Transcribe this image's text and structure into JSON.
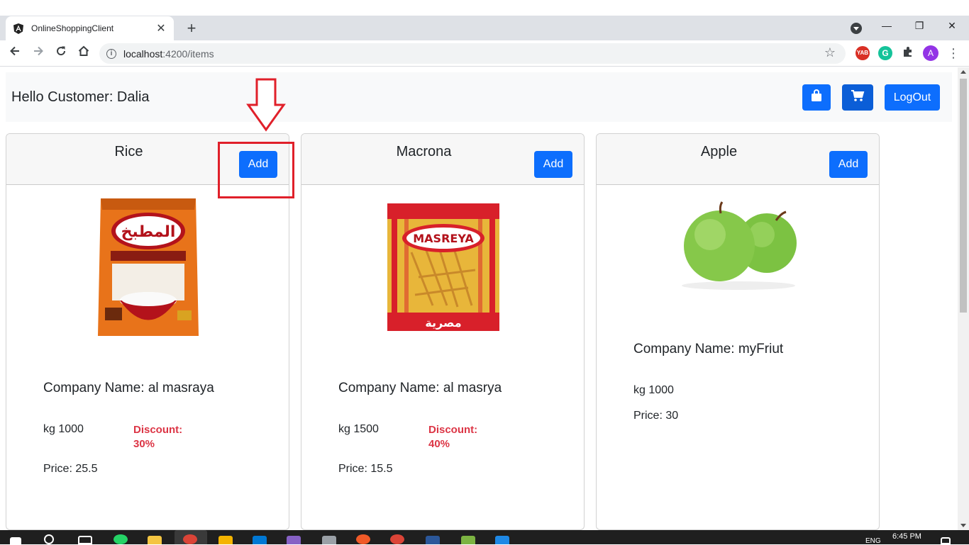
{
  "browser": {
    "tab_title": "OnlineShoppingClient",
    "tab_close": "✕",
    "new_tab": "+",
    "url_host": "localhost",
    "url_path": ":4200/items",
    "win_minimize": "—",
    "win_restore": "❐",
    "win_close": "✕"
  },
  "extensions": [
    {
      "name": "ext-yab",
      "label": "YAB",
      "color": "#d93025"
    },
    {
      "name": "grammarly",
      "label": "G",
      "color": "#15c39a"
    },
    {
      "name": "avatar",
      "label": "A",
      "color": "#9334e6"
    }
  ],
  "header": {
    "greeting": "Hello Customer: Dalia",
    "logout_label": "LogOut"
  },
  "products": [
    {
      "title": "Rice",
      "add_label": "Add",
      "company": "Company Name: al masraya",
      "weight": "kg 1000",
      "discount_label": "Discount:",
      "discount_value": "30%",
      "price": "Price: 25.5",
      "image": "rice-bag",
      "image_text": "المطبخ"
    },
    {
      "title": "Macrona",
      "add_label": "Add",
      "company": "Company Name: al masrya",
      "weight": "kg 1500",
      "discount_label": "Discount:",
      "discount_value": "40%",
      "price": "Price: 15.5",
      "image": "pasta-bag",
      "image_text": "MASREYA"
    },
    {
      "title": "Apple",
      "add_label": "Add",
      "company": "Company Name: myFriut",
      "weight": "kg 1000",
      "price": "Price: 30",
      "image": "green-apples"
    }
  ],
  "taskbar": {
    "clock": "6:45 PM",
    "lang": "ENG"
  },
  "colors": {
    "primary": "#0d6efd",
    "danger": "#dc3545",
    "annotation": "#e0202a"
  }
}
